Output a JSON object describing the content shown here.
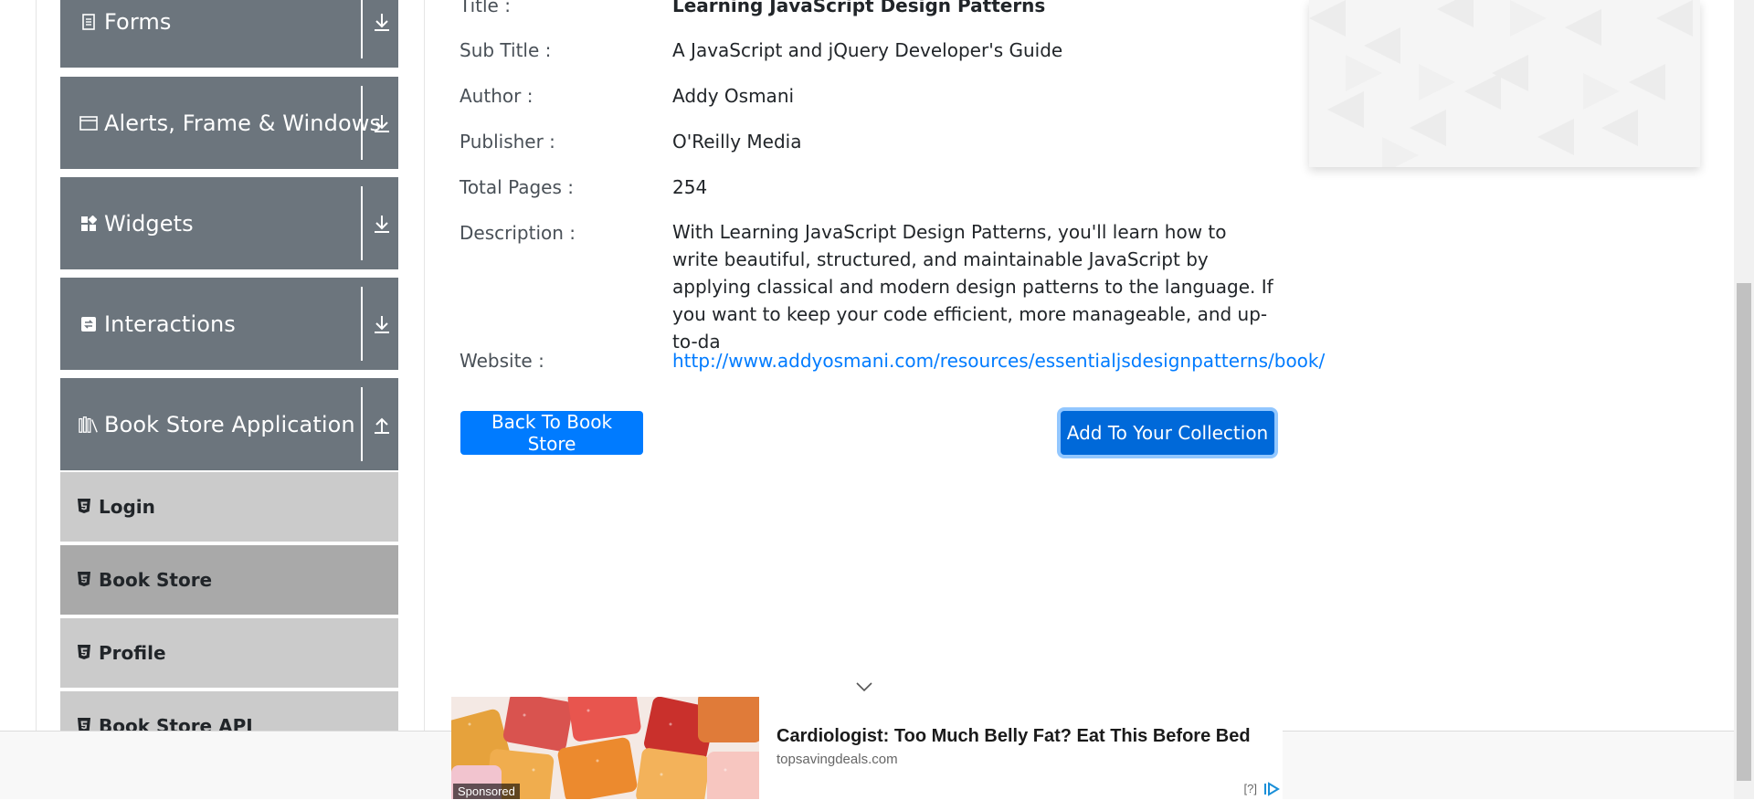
{
  "sidebar": {
    "groups": [
      {
        "label": "Forms",
        "icon": "document-icon",
        "expanded": false
      },
      {
        "label": "Alerts, Frame & Windows",
        "icon": "window-icon",
        "expanded": false
      },
      {
        "label": "Widgets",
        "icon": "widgets-icon",
        "expanded": false
      },
      {
        "label": "Interactions",
        "icon": "interactions-icon",
        "expanded": false
      },
      {
        "label": "Book Store Application",
        "icon": "bookshelf-icon",
        "expanded": true
      }
    ],
    "book_store_items": [
      {
        "label": "Login",
        "active": false
      },
      {
        "label": "Book Store",
        "active": true
      },
      {
        "label": "Profile",
        "active": false
      },
      {
        "label": "Book Store API",
        "active": false
      }
    ]
  },
  "book": {
    "title_label": "Title :",
    "title": "Learning JavaScript Design Patterns",
    "subtitle_label": "Sub Title :",
    "subtitle": "A JavaScript and jQuery Developer's Guide",
    "author_label": "Author :",
    "author": "Addy Osmani",
    "publisher_label": "Publisher :",
    "publisher": "O'Reilly Media",
    "pages_label": "Total Pages :",
    "pages": "254",
    "description_label": "Description :",
    "description": "With Learning JavaScript Design Patterns, you'll learn how to write beautiful, structured, and maintainable JavaScript by applying classical and modern design patterns to the language. If you want to keep your code efficient, more manageable, and up-to-da",
    "website_label": "Website :",
    "website": "http://www.addyosmani.com/resources/essentialjsdesignpatterns/book/"
  },
  "actions": {
    "back_label": "Back To Book Store",
    "add_label": "Add To Your Collection"
  },
  "ad": {
    "headline": "Cardiologist: Too Much Belly Fat? Eat This Before Bed",
    "domain": "topsavingdeals.com",
    "sponsored": "Sponsored",
    "info": "[?]"
  },
  "colors": {
    "accent": "#007bff",
    "sidebar_group": "#6c757d",
    "sidebar_item": "#cbcbcb",
    "sidebar_item_active": "#a9a9a9"
  }
}
